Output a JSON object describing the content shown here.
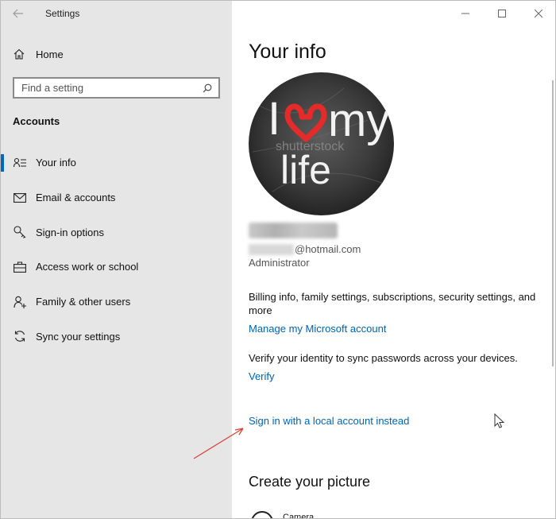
{
  "window": {
    "title": "Settings"
  },
  "sidebar": {
    "home_label": "Home",
    "search_placeholder": "Find a setting",
    "section_title": "Accounts",
    "items": [
      {
        "label": "Your info",
        "icon": "person-list-icon",
        "active": true
      },
      {
        "label": "Email & accounts",
        "icon": "mail-icon",
        "active": false
      },
      {
        "label": "Sign-in options",
        "icon": "key-icon",
        "active": false
      },
      {
        "label": "Access work or school",
        "icon": "briefcase-icon",
        "active": false
      },
      {
        "label": "Family & other users",
        "icon": "person-add-icon",
        "active": false
      },
      {
        "label": "Sync your settings",
        "icon": "sync-icon",
        "active": false
      }
    ]
  },
  "content": {
    "page_title": "Your info",
    "avatar_text": {
      "line1_left": "I",
      "line1_right": "my",
      "line2": "life",
      "watermark": "shutterstock"
    },
    "email_suffix": "@hotmail.com",
    "role": "Administrator",
    "billing_text": "Billing info, family settings, subscriptions, security settings, and more",
    "manage_link": "Manage my Microsoft account",
    "verify_text": "Verify your identity to sync passwords across your devices.",
    "verify_link": "Verify",
    "local_account_link": "Sign in with a local account instead",
    "create_picture_title": "Create your picture",
    "camera_label": "Camera"
  },
  "colors": {
    "accent": "#0067c0",
    "link": "#0063b1",
    "sidebar_bg": "#e6e6e6",
    "annotation_arrow": "#d9443a"
  }
}
